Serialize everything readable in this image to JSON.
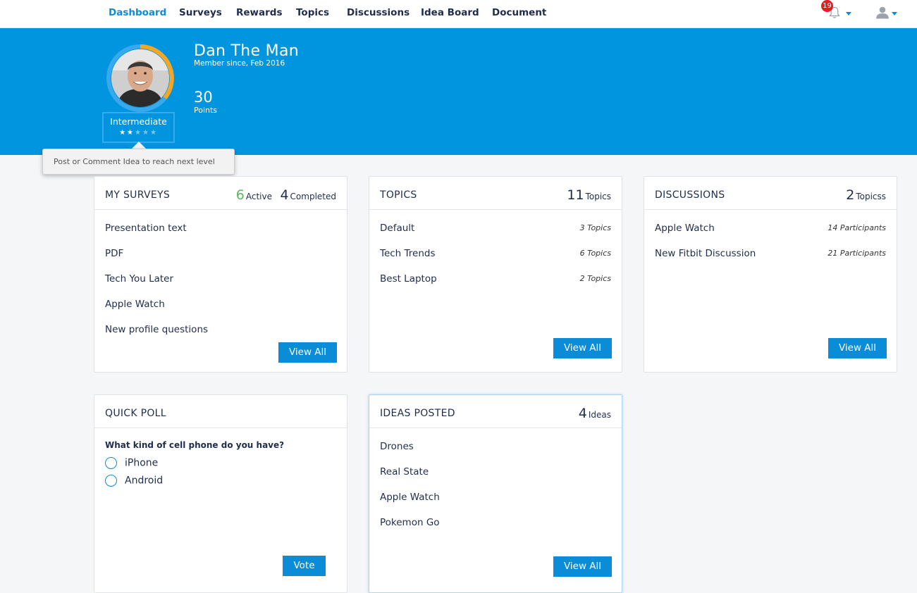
{
  "nav": {
    "items": [
      "Dashboard",
      "Surveys",
      "Rewards",
      "Topics",
      "Discussions",
      "Idea Board",
      "Document"
    ],
    "notification_count": "19"
  },
  "profile": {
    "name": "Dan The Man",
    "member_since": "Member since, Feb 2016",
    "points": "30",
    "points_label": "Points",
    "level": "Intermediate",
    "stars_filled": 2,
    "stars_total": 5,
    "tooltip": "Post or Comment Idea to reach next level"
  },
  "surveys": {
    "title": "MY SURVEYS",
    "active_count": "6",
    "active_label": "Active",
    "completed_count": "4",
    "completed_label": "Completed",
    "items": [
      "Presentation text",
      "PDF",
      "Tech You Later",
      "Apple Watch",
      "New profile questions"
    ],
    "button": "View All"
  },
  "topics": {
    "title": "TOPICS",
    "count": "11",
    "count_label": "Topics",
    "items": [
      {
        "label": "Default",
        "meta": "3 Topics"
      },
      {
        "label": "Tech Trends",
        "meta": "6 Topics"
      },
      {
        "label": "Best Laptop",
        "meta": "2 Topics"
      }
    ],
    "button": "View All"
  },
  "discussions": {
    "title": "DISCUSSIONS",
    "count": "2",
    "count_label": "Topicss",
    "items": [
      {
        "label": "Apple Watch",
        "meta": "14 Participants"
      },
      {
        "label": "New Fitbit Discussion",
        "meta": "21 Participants"
      }
    ],
    "button": "View All"
  },
  "poll": {
    "title": "QUICK POLL",
    "question": "What kind of cell phone do you have?",
    "options": [
      "iPhone",
      "Android"
    ],
    "button": "Vote"
  },
  "ideas": {
    "title": "IDEAS POSTED",
    "count": "4",
    "count_label": "Ideas",
    "items": [
      "Drones",
      "Real State",
      "Apple Watch",
      "Pokemon Go"
    ],
    "button": "View All"
  },
  "colors": {
    "brand_blue": "#0095de",
    "button_blue": "#0a8cd6",
    "active_green": "#5cb85c",
    "badge_red": "#e8191f",
    "ring_orange": "#f5a623"
  }
}
